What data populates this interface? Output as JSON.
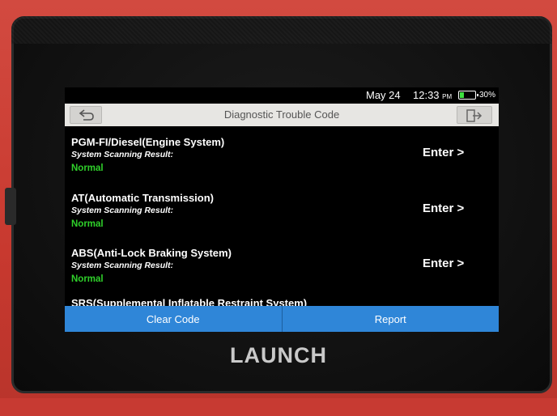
{
  "status": {
    "date": "May 24",
    "time": "12:33",
    "ampm": "PM",
    "battery_pct": "30%",
    "battery_level": 0.3
  },
  "header": {
    "title": "Diagnostic Trouble Code",
    "back_icon": "back-arrow-icon",
    "exit_icon": "exit-icon"
  },
  "systems": [
    {
      "name": "PGM-FI/Diesel(Engine System)",
      "result_label": "System Scanning Result:",
      "result": "Normal",
      "action": "Enter >"
    },
    {
      "name": "AT(Automatic Transmission)",
      "result_label": "System Scanning Result:",
      "result": "Normal",
      "action": "Enter >"
    },
    {
      "name": "ABS(Anti-Lock Braking System)",
      "result_label": "System Scanning Result:",
      "result": "Normal",
      "action": "Enter >"
    },
    {
      "name": "SRS(Supplemental Inflatable Restraint System)"
    }
  ],
  "footer": {
    "clear_code": "Clear Code",
    "report": "Report"
  },
  "device": {
    "brand": "LAUNCH"
  },
  "colors": {
    "accent_blue": "#2f86d8",
    "status_green": "#2fd02a",
    "housing_red": "#c8392f"
  }
}
